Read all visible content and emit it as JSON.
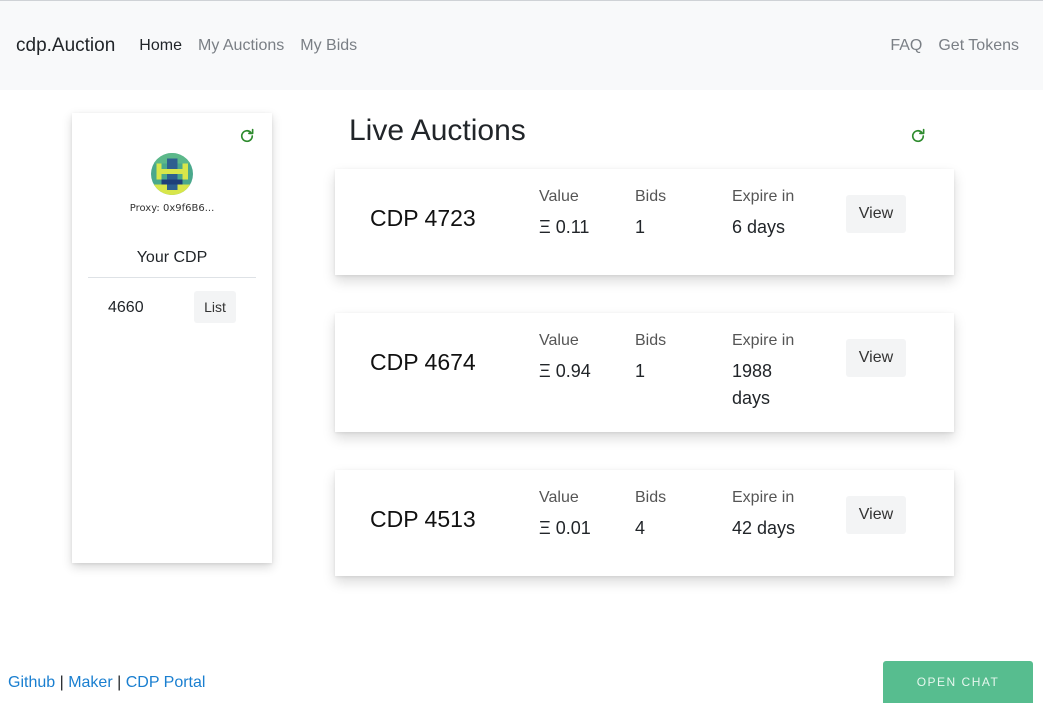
{
  "navbar": {
    "brand": "cdp.Auction",
    "links": [
      {
        "label": "Home",
        "active": true
      },
      {
        "label": "My Auctions",
        "active": false
      },
      {
        "label": "My Bids",
        "active": false
      }
    ],
    "right_links": [
      {
        "label": "FAQ"
      },
      {
        "label": "Get Tokens"
      }
    ]
  },
  "profile": {
    "refresh_icon": "refresh-icon",
    "avatar_icon": "identicon-avatar",
    "proxy_label": "Proxy: 0x9f6B6...",
    "your_cdp_title": "Your CDP",
    "cdps": [
      {
        "number": "4660",
        "action_label": "List"
      }
    ]
  },
  "auctions": {
    "title": "Live Auctions",
    "refresh_icon": "refresh-icon",
    "labels": {
      "value": "Value",
      "bids": "Bids",
      "expire": "Expire in"
    },
    "items": [
      {
        "cdp": "CDP 4723",
        "value": "Ξ 0.11",
        "bids": "1",
        "expire": "6 days",
        "action_label": "View"
      },
      {
        "cdp": "CDP 4674",
        "value": "Ξ 0.94",
        "bids": "1",
        "expire": "1988 days",
        "action_label": "View"
      },
      {
        "cdp": "CDP 4513",
        "value": "Ξ 0.01",
        "bids": "4",
        "expire": "42 days",
        "action_label": "View"
      }
    ]
  },
  "footer": {
    "links": [
      "Github",
      "Maker",
      "CDP Portal"
    ],
    "separator": "|"
  },
  "chat": {
    "label": "OPEN CHAT"
  },
  "colors": {
    "accent_green": "#57bd8f",
    "refresh_green": "#2e8b2e",
    "link_blue": "#1a7fd0",
    "navbar_bg": "#f8f9fa"
  }
}
